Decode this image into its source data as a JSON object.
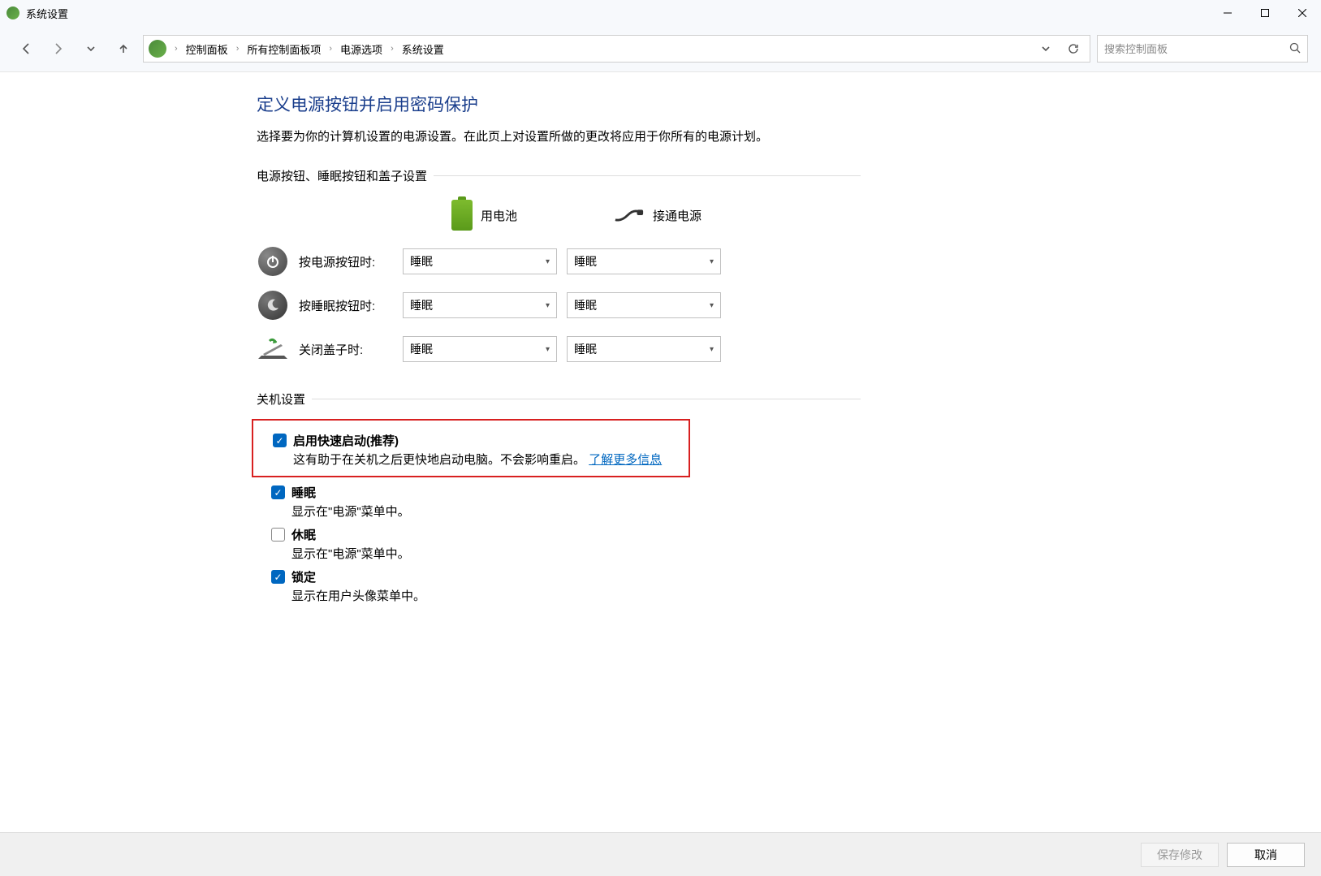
{
  "window": {
    "title": "系统设置"
  },
  "breadcrumb": {
    "items": [
      "控制面板",
      "所有控制面板项",
      "电源选项",
      "系统设置"
    ]
  },
  "search": {
    "placeholder": "搜索控制面板"
  },
  "page": {
    "title": "定义电源按钮并启用密码保护",
    "desc": "选择要为你的计算机设置的电源设置。在此页上对设置所做的更改将应用于你所有的电源计划。"
  },
  "section1": {
    "title": "电源按钮、睡眠按钮和盖子设置",
    "col_battery": "用电池",
    "col_ac": "接通电源",
    "rows": [
      {
        "label": "按电源按钮时:",
        "battery": "睡眠",
        "ac": "睡眠"
      },
      {
        "label": "按睡眠按钮时:",
        "battery": "睡眠",
        "ac": "睡眠"
      },
      {
        "label": "关闭盖子时:",
        "battery": "睡眠",
        "ac": "睡眠"
      }
    ]
  },
  "section2": {
    "title": "关机设置",
    "fast_startup": {
      "label": "启用快速启动(推荐)",
      "desc_prefix": "这有助于在关机之后更快地启动电脑。不会影响重启。",
      "link": "了解更多信息"
    },
    "sleep": {
      "label": "睡眠",
      "desc": "显示在\"电源\"菜单中。"
    },
    "hibernate": {
      "label": "休眠",
      "desc": "显示在\"电源\"菜单中。"
    },
    "lock": {
      "label": "锁定",
      "desc": "显示在用户头像菜单中。"
    }
  },
  "footer": {
    "save": "保存修改",
    "cancel": "取消"
  }
}
